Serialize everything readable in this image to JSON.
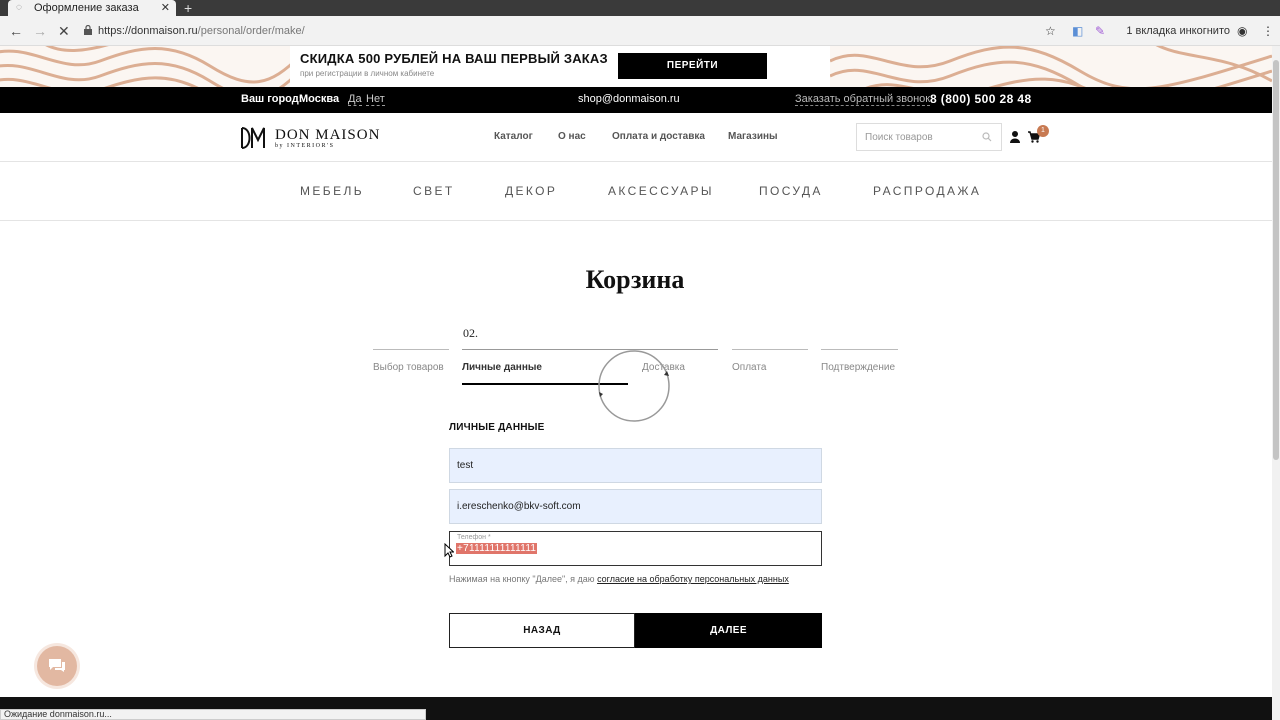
{
  "browser": {
    "tab_title": "Оформление заказа",
    "url_host": "https://donmaison.ru",
    "url_path": "/personal/order/make/",
    "incognito": "1 вкладка инкогнито",
    "status_text": "Ожидание donmaison.ru..."
  },
  "promo": {
    "title": "СКИДКА 500 РУБЛЕЙ НА ВАШ ПЕРВЫЙ ЗАКАЗ",
    "subtitle": "при регистрации в личном кабинете",
    "button": "ПЕРЕЙТИ"
  },
  "topbar": {
    "city_label": "Ваш город:",
    "city": "Москва",
    "yes": "Да",
    "no": "Нет",
    "email": "shop@donmaison.ru",
    "callback": "Заказать обратный звонок",
    "phone": "8 (800) 500 28 48"
  },
  "header": {
    "logo_text": "DON MAISON",
    "logo_sub": "by INTERIOR'S",
    "nav": [
      "Каталог",
      "О нас",
      "Оплата и доставка",
      "Магазины"
    ],
    "search_placeholder": "Поиск товаров",
    "cart_count": "1"
  },
  "categories": [
    "МЕБЕЛЬ",
    "СВЕТ",
    "ДЕКОР",
    "АКСЕССУАРЫ",
    "ПОСУДА",
    "РАСПРОДАЖА"
  ],
  "main": {
    "title": "Корзина",
    "step_number": "02.",
    "steps": [
      "Выбор товаров",
      "Личные данные",
      "Доставка",
      "Оплата",
      "Подтверждение"
    ],
    "active_step": 1,
    "section_title": "ЛИЧНЫЕ ДАННЫЕ",
    "name_value": "test",
    "email_value": "i.ereschenko@bkv-soft.com",
    "phone_label": "Телефон *",
    "phone_value": "+71111111111111",
    "consent_text": "Нажимая на кнопку \"Далее\", я даю ",
    "consent_link": "согласие на обработку персональных данных",
    "back_button": "НАЗАД",
    "next_button": "ДАЛЕЕ"
  },
  "colors": {
    "accent": "#c87a52",
    "autofill": "#e8f0fe",
    "selection": "#e0756a"
  }
}
